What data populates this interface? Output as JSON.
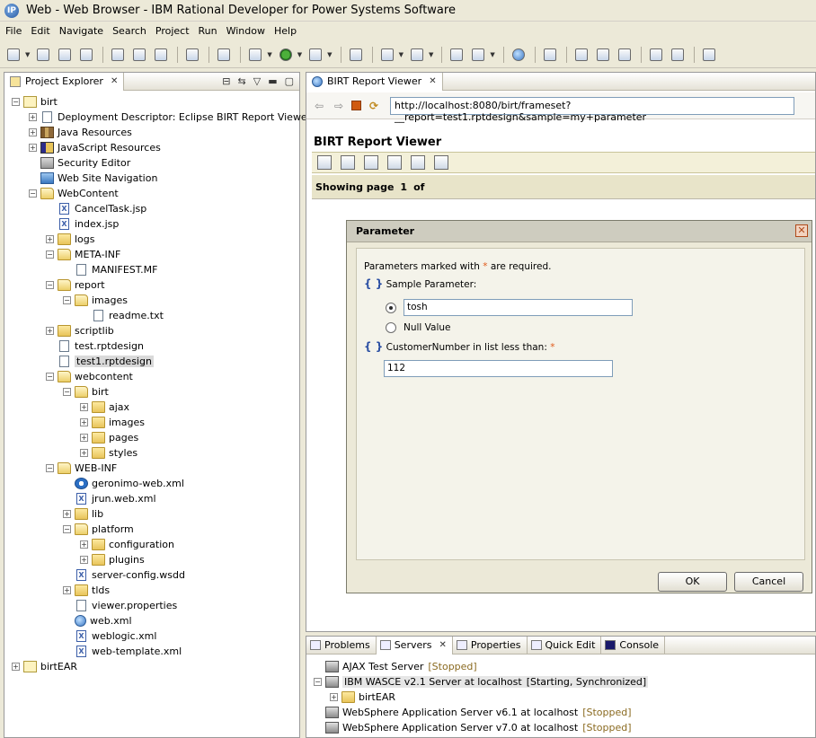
{
  "window": {
    "title": "Web - Web Browser - IBM Rational Developer for Power Systems Software"
  },
  "menubar": [
    "File",
    "Edit",
    "Navigate",
    "Search",
    "Project",
    "Run",
    "Window",
    "Help"
  ],
  "project_explorer": {
    "tab_label": "Project Explorer",
    "tree": [
      {
        "label": "birt",
        "level": 0,
        "expander": "minus",
        "icon": "project-icon"
      },
      {
        "label": "Deployment Descriptor: Eclipse BIRT Report Viewer",
        "level": 1,
        "expander": "plus",
        "icon": "descriptor-icon"
      },
      {
        "label": "Java Resources",
        "level": 1,
        "expander": "plus",
        "icon": "java-resources-icon"
      },
      {
        "label": "JavaScript Resources",
        "level": 1,
        "expander": "plus",
        "icon": "javascript-resources-icon"
      },
      {
        "label": "Security Editor",
        "level": 1,
        "expander": "none",
        "icon": "security-editor-icon"
      },
      {
        "label": "Web Site Navigation",
        "level": 1,
        "expander": "none",
        "icon": "navigation-icon"
      },
      {
        "label": "WebContent",
        "level": 1,
        "expander": "minus",
        "icon": "folder-open-icon"
      },
      {
        "label": "CancelTask.jsp",
        "level": 2,
        "expander": "none",
        "icon": "jsp-file-icon"
      },
      {
        "label": "index.jsp",
        "level": 2,
        "expander": "none",
        "icon": "jsp-file-icon"
      },
      {
        "label": "logs",
        "level": 2,
        "expander": "plus",
        "icon": "folder-icon"
      },
      {
        "label": "META-INF",
        "level": 2,
        "expander": "minus",
        "icon": "folder-open-icon"
      },
      {
        "label": "MANIFEST.MF",
        "level": 3,
        "expander": "none",
        "icon": "manifest-file-icon"
      },
      {
        "label": "report",
        "level": 2,
        "expander": "minus",
        "icon": "folder-open-icon"
      },
      {
        "label": "images",
        "level": 3,
        "expander": "minus",
        "icon": "folder-open-icon"
      },
      {
        "label": "readme.txt",
        "level": 4,
        "expander": "none",
        "icon": "text-file-icon"
      },
      {
        "label": "scriptlib",
        "level": 2,
        "expander": "plus",
        "icon": "folder-icon"
      },
      {
        "label": "test.rptdesign",
        "level": 2,
        "expander": "none",
        "icon": "report-design-icon"
      },
      {
        "label": "test1.rptdesign",
        "level": 2,
        "expander": "none",
        "icon": "report-design-icon",
        "selected": true
      },
      {
        "label": "webcontent",
        "level": 2,
        "expander": "minus",
        "icon": "folder-open-icon"
      },
      {
        "label": "birt",
        "level": 3,
        "expander": "minus",
        "icon": "folder-open-icon"
      },
      {
        "label": "ajax",
        "level": 4,
        "expander": "plus",
        "icon": "folder-icon"
      },
      {
        "label": "images",
        "level": 4,
        "expander": "plus",
        "icon": "folder-icon"
      },
      {
        "label": "pages",
        "level": 4,
        "expander": "plus",
        "icon": "folder-icon"
      },
      {
        "label": "styles",
        "level": 4,
        "expander": "plus",
        "icon": "folder-icon"
      },
      {
        "label": "WEB-INF",
        "level": 2,
        "expander": "minus",
        "icon": "folder-open-icon"
      },
      {
        "label": "geronimo-web.xml",
        "level": 3,
        "expander": "none",
        "icon": "geronimo-xml-icon"
      },
      {
        "label": "jrun.web.xml",
        "level": 3,
        "expander": "none",
        "icon": "xml-file-icon"
      },
      {
        "label": "lib",
        "level": 3,
        "expander": "plus",
        "icon": "folder-icon"
      },
      {
        "label": "platform",
        "level": 3,
        "expander": "minus",
        "icon": "folder-open-icon"
      },
      {
        "label": "configuration",
        "level": 4,
        "expander": "plus",
        "icon": "folder-icon"
      },
      {
        "label": "plugins",
        "level": 4,
        "expander": "plus",
        "icon": "folder-icon"
      },
      {
        "label": "server-config.wsdd",
        "level": 3,
        "expander": "none",
        "icon": "xml-file-icon"
      },
      {
        "label": "tlds",
        "level": 3,
        "expander": "plus",
        "icon": "folder-icon"
      },
      {
        "label": "viewer.properties",
        "level": 3,
        "expander": "none",
        "icon": "properties-file-icon"
      },
      {
        "label": "web.xml",
        "level": 3,
        "expander": "none",
        "icon": "web-xml-icon"
      },
      {
        "label": "weblogic.xml",
        "level": 3,
        "expander": "none",
        "icon": "xml-file-icon"
      },
      {
        "label": "web-template.xml",
        "level": 3,
        "expander": "none",
        "icon": "xml-file-icon"
      },
      {
        "label": "birtEAR",
        "level": 0,
        "expander": "plus",
        "icon": "ear-project-icon"
      }
    ]
  },
  "editor": {
    "tab_label": "BIRT Report Viewer",
    "url": "http://localhost:8080/birt/frameset?__report=test1.rptdesign&sample=my+parameter",
    "viewer_title": "BIRT Report Viewer",
    "page_label": "Showing page",
    "page_number": "1",
    "page_of": "of"
  },
  "dialog": {
    "title": "Parameter",
    "required_note_prefix": "Parameters marked with",
    "required_star": "*",
    "required_note_suffix": "are required.",
    "param1_label": "Sample Parameter:",
    "param1_value": "tosh",
    "param1_null_label": "Null Value",
    "param2_label": "CustomerNumber in list less than:",
    "param2_value": "112",
    "ok_label": "OK",
    "cancel_label": "Cancel"
  },
  "bottom_tabs": [
    {
      "label": "Problems",
      "active": false
    },
    {
      "label": "Servers",
      "active": true
    },
    {
      "label": "Properties",
      "active": false
    },
    {
      "label": "Quick Edit",
      "active": false
    },
    {
      "label": "Console",
      "active": false
    }
  ],
  "servers": [
    {
      "name": "AJAX Test Server",
      "status": "[Stopped]",
      "expander": "none",
      "level": 0
    },
    {
      "name": "IBM WASCE v2.1 Server at localhost",
      "status": "[Starting, Synchronized]",
      "expander": "minus",
      "level": 0,
      "highlight": true
    },
    {
      "name": "birtEAR",
      "status": "",
      "expander": "plus",
      "level": 1
    },
    {
      "name": "WebSphere Application Server v6.1 at localhost",
      "status": "[Stopped]",
      "expander": "none",
      "level": 0
    },
    {
      "name": "WebSphere Application Server v7.0 at localhost",
      "status": "[Stopped]",
      "expander": "none",
      "level": 0
    }
  ]
}
